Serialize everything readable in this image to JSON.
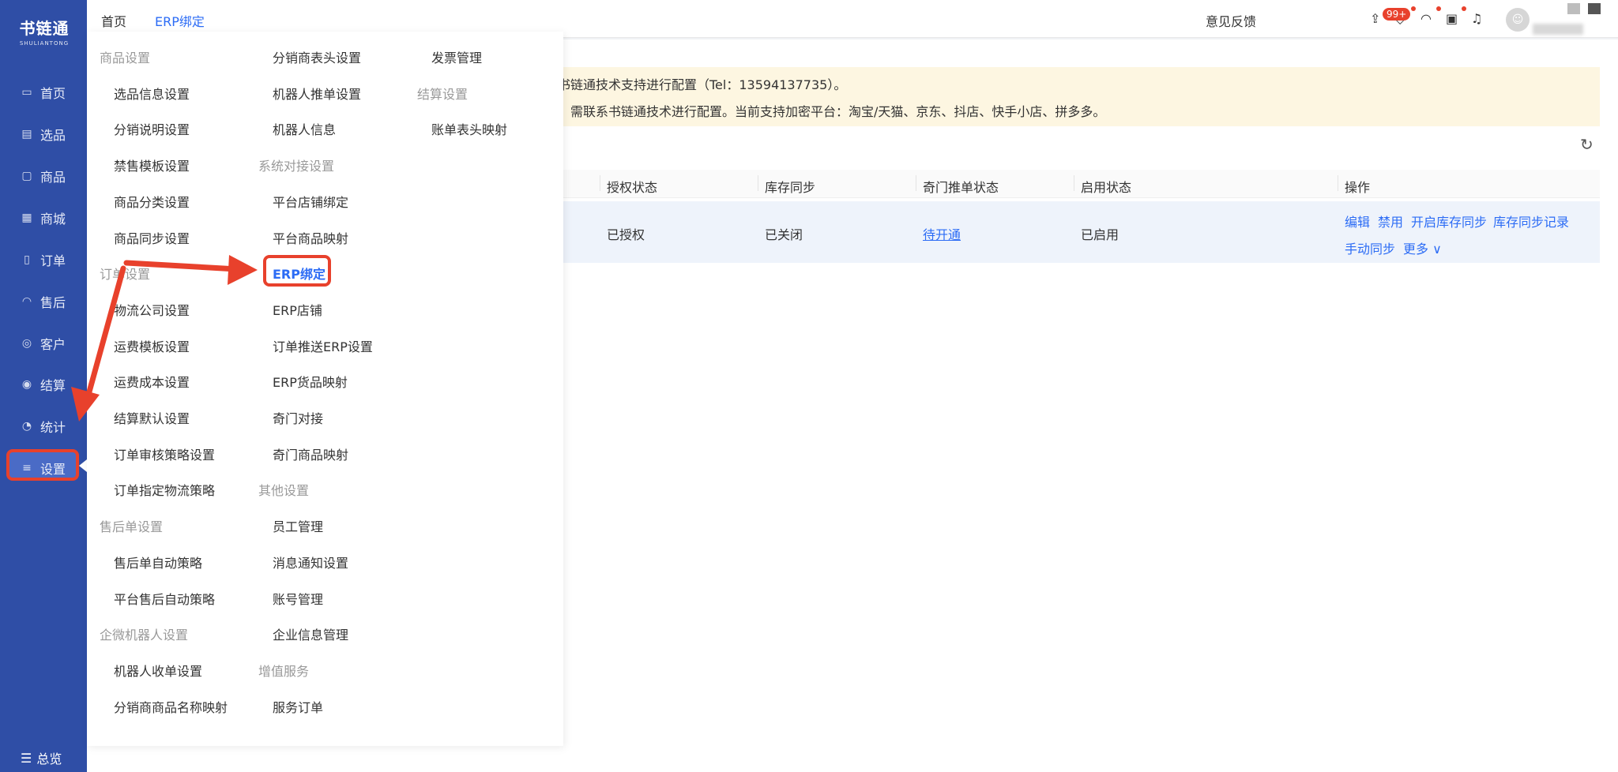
{
  "logo": {
    "name": "书链通",
    "sub": "SHULIANTONG"
  },
  "sidebar": {
    "items": [
      {
        "label": "首页",
        "icon": "monitor-icon"
      },
      {
        "label": "选品",
        "icon": "clipboard-icon"
      },
      {
        "label": "商品",
        "icon": "box-icon"
      },
      {
        "label": "商城",
        "icon": "store-icon"
      },
      {
        "label": "订单",
        "icon": "document-icon"
      },
      {
        "label": "售后",
        "icon": "headset-icon"
      },
      {
        "label": "客户",
        "icon": "users-icon"
      },
      {
        "label": "结算",
        "icon": "settle-icon"
      },
      {
        "label": "统计",
        "icon": "pie-chart-icon"
      },
      {
        "label": "设置",
        "icon": "sliders-icon"
      }
    ],
    "overview": "总览"
  },
  "topbar": {
    "tabs": [
      "首页",
      "ERP绑定"
    ],
    "feedback": "意见反馈",
    "badge": "99+"
  },
  "notice": {
    "line1": "书链通技术支持进行配置（Tel：13594137735）。",
    "line2": "需联系书链通技术进行配置。当前支持加密平台：淘宝/天猫、京东、抖店、快手小店、拼多多。"
  },
  "table": {
    "headers": [
      "授权状态",
      "库存同步",
      "奇门推单状态",
      "启用状态",
      "操作"
    ],
    "row": {
      "auth": "已授权",
      "stock_sync": "已关闭",
      "qimen": "待开通",
      "enabled": "已启用",
      "ops": [
        "编辑",
        "禁用",
        "开启库存同步",
        "库存同步记录",
        "手动同步",
        "更多"
      ]
    }
  },
  "menu": {
    "col1": [
      {
        "text": "商品设置",
        "header": true
      },
      {
        "text": "选品信息设置"
      },
      {
        "text": "分销说明设置"
      },
      {
        "text": "禁售模板设置"
      },
      {
        "text": "商品分类设置"
      },
      {
        "text": "商品同步设置"
      },
      {
        "text": "订单设置",
        "header": true
      },
      {
        "text": "物流公司设置"
      },
      {
        "text": "运费模板设置"
      },
      {
        "text": "运费成本设置"
      },
      {
        "text": "结算默认设置"
      },
      {
        "text": "订单审核策略设置"
      },
      {
        "text": "订单指定物流策略"
      },
      {
        "text": "售后单设置",
        "header": true
      },
      {
        "text": "售后单自动策略"
      },
      {
        "text": "平台售后自动策略"
      },
      {
        "text": "企微机器人设置",
        "header": true
      },
      {
        "text": "机器人收单设置"
      },
      {
        "text": "分销商商品名称映射"
      }
    ],
    "col2": [
      {
        "text": "分销商表头设置"
      },
      {
        "text": "机器人推单设置"
      },
      {
        "text": "机器人信息"
      },
      {
        "text": "系统对接设置",
        "header": true
      },
      {
        "text": "平台店铺绑定"
      },
      {
        "text": "平台商品映射"
      },
      {
        "text": "ERP绑定",
        "active": true
      },
      {
        "text": "ERP店铺"
      },
      {
        "text": "订单推送ERP设置"
      },
      {
        "text": "ERP货品映射"
      },
      {
        "text": "奇门对接"
      },
      {
        "text": "奇门商品映射"
      },
      {
        "text": "其他设置",
        "header": true
      },
      {
        "text": "员工管理"
      },
      {
        "text": "消息通知设置"
      },
      {
        "text": "账号管理"
      },
      {
        "text": "企业信息管理"
      },
      {
        "text": "增值服务",
        "header": true
      },
      {
        "text": "服务订单"
      }
    ],
    "col3": [
      {
        "text": "发票管理"
      },
      {
        "text": "结算设置",
        "header": true
      },
      {
        "text": "账单表头映射"
      }
    ]
  },
  "colors": {
    "sidebar": "#2f4ea6",
    "accent": "#2c6cf5",
    "highlight": "#e8412c",
    "notice_bg": "#fdf6e1"
  }
}
